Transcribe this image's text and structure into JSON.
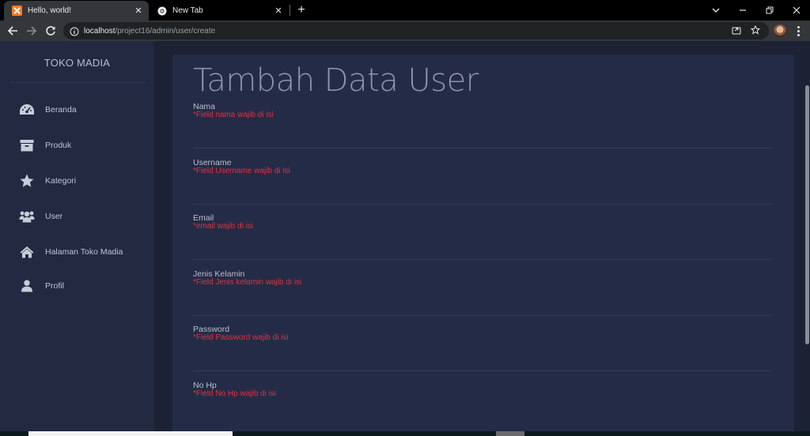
{
  "browser": {
    "tabs": [
      {
        "title": "Hello, world!",
        "active": true,
        "icon": "xampp-icon"
      },
      {
        "title": "New Tab",
        "active": false,
        "icon": "chrome-icon"
      }
    ],
    "url_host": "localhost",
    "url_path": "/project16/admin/user/create"
  },
  "sidebar": {
    "brand": "TOKO MADIA",
    "items": [
      {
        "label": "Beranda",
        "icon": "dashboard-icon"
      },
      {
        "label": "Produk",
        "icon": "archive-box-icon"
      },
      {
        "label": "Kategori",
        "icon": "star-icon"
      },
      {
        "label": "User",
        "icon": "users-icon"
      },
      {
        "label": "Halaman Toko Madia",
        "icon": "home-icon"
      },
      {
        "label": "Profil",
        "icon": "user-icon"
      }
    ]
  },
  "form": {
    "title": "Tambah Data User",
    "fields": [
      {
        "label": "Nama",
        "error": "*Field nama wajib di isi",
        "value": ""
      },
      {
        "label": "Username",
        "error": "*Field Username wajib di isi",
        "value": ""
      },
      {
        "label": "Email",
        "error": "*email wajib di isi",
        "value": ""
      },
      {
        "label": "Jenis Kelamin",
        "error": "*Field Jenis kelamin wajib di isi",
        "value": ""
      },
      {
        "label": "Password",
        "error": "*Field Password wajib di isi",
        "value": ""
      },
      {
        "label": "No Hp",
        "error": "*Field No Hp wajib di isi",
        "value": ""
      }
    ]
  },
  "colors": {
    "sidebar_bg": "#222941",
    "page_bg": "#1c2134",
    "card_bg": "#242b46",
    "error_red": "#e2313f"
  }
}
